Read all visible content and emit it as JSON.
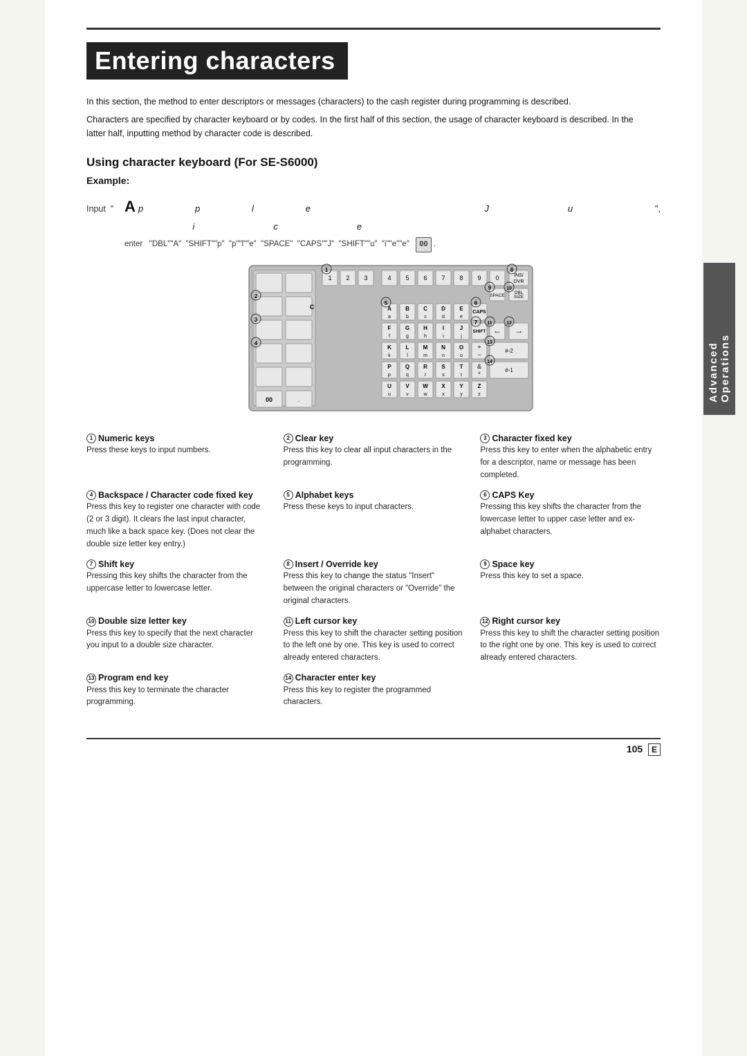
{
  "page": {
    "title": "Entering characters",
    "top_rule": true,
    "intro_paragraphs": [
      "In this section, the method to enter descriptors or messages (characters) to the cash register during programming is described.",
      "Characters are specified by character keyboard or by codes. In the first half of this section, the usage of character keyboard is described. In the latter half, inputting method by character code is described."
    ],
    "section_title": "Using character keyboard (For SE-S6000)",
    "example_label": "Example:",
    "input_label": "Input \"",
    "input_chars": "A    p    p    l    e         J    u    i    c    e",
    "input_end": "\",",
    "enter_label": "enter",
    "enter_codes": "\"DBL\"\"A\"  \"SHIFT\"\"p\"  \"p\"\"l\"\"e\"  \"SPACE\"  \"CAPS\"\"J\"  \"SHIFT\"\"u\"  \"i\"\"e\"\"e\"",
    "enter_box": "00",
    "enter_dot": ".",
    "sidebar_label": "Advanced Operations",
    "page_number": "105",
    "page_letter": "E"
  },
  "keyboard": {
    "note": "Keyboard diagram with labeled keys"
  },
  "descriptions": [
    {
      "num": "①",
      "title": "Numeric keys",
      "text": "Press these keys to input numbers."
    },
    {
      "num": "②",
      "title": "Clear key",
      "text": "Press this key to clear all input characters in the programming."
    },
    {
      "num": "③",
      "title": "Character fixed key",
      "text": "Press this key to enter when the alphabetic entry for a descriptor, name or message has been completed."
    },
    {
      "num": "④",
      "title": "Backspace / Character code fixed key",
      "text": "Press this key to register one character with code (2 or 3 digit). It clears the last input character, much like a back space key. (Does not clear the double size letter key entry.)"
    },
    {
      "num": "⑤",
      "title": "Alphabet keys",
      "text": "Press these keys to input characters."
    },
    {
      "num": "⑥",
      "title": "CAPS Key",
      "text": "Pressing this key shifts the character from the lowercase letter to upper case letter and ex-alphabet characters."
    },
    {
      "num": "⑦",
      "title": "Shift key",
      "text": "Pressing this key shifts the character from the uppercase letter to lowercase letter."
    },
    {
      "num": "⑧",
      "title": "Insert / Override key",
      "text": "Press this key to change the status \"Insert\" between the original characters or \"Override\" the original characters."
    },
    {
      "num": "⑨",
      "title": "Space key",
      "text": "Press this key to set a space."
    },
    {
      "num": "⑩",
      "title": "Double size letter key",
      "text": "Press this key to specify that the next character you input to a double size character."
    },
    {
      "num": "⑪",
      "title": "Left cursor key",
      "text": "Press this key to shift the character setting position to the left one by one. This key is used to correct already entered characters."
    },
    {
      "num": "⑫",
      "title": "Right cursor key",
      "text": "Press this key to shift the character setting position to the right one by one. This key is used to correct already entered characters."
    },
    {
      "num": "⑬",
      "title": "Program end key",
      "text": "Press this key to terminate the character programming."
    },
    {
      "num": "⑭",
      "title": "Character enter key",
      "text": "Press this key to register the programmed characters."
    }
  ]
}
